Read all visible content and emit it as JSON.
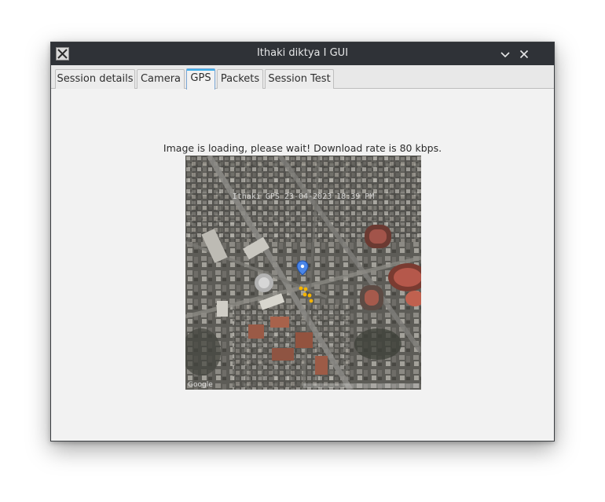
{
  "window": {
    "title": "Ithaki diktya I GUI",
    "app_icon": "x-logo-icon",
    "controls": [
      "minimize-icon",
      "close-icon"
    ]
  },
  "tabs": [
    {
      "label": "Session details",
      "active": false
    },
    {
      "label": "Camera",
      "active": false
    },
    {
      "label": "GPS",
      "active": true
    },
    {
      "label": "Packets",
      "active": false
    },
    {
      "label": "Session Test",
      "active": false
    }
  ],
  "gps": {
    "status_text": "Image is loading, please wait! Download rate is 80 kbps.",
    "map_overlay_text": "Ithaki GPS 23-04-2023 18:39 PM",
    "map_brand": "Google"
  },
  "colors": {
    "titlebar": "#2f3237",
    "accent": "#3daee9",
    "marker": "#4a86e8",
    "gps_dots": "#f4b400"
  }
}
